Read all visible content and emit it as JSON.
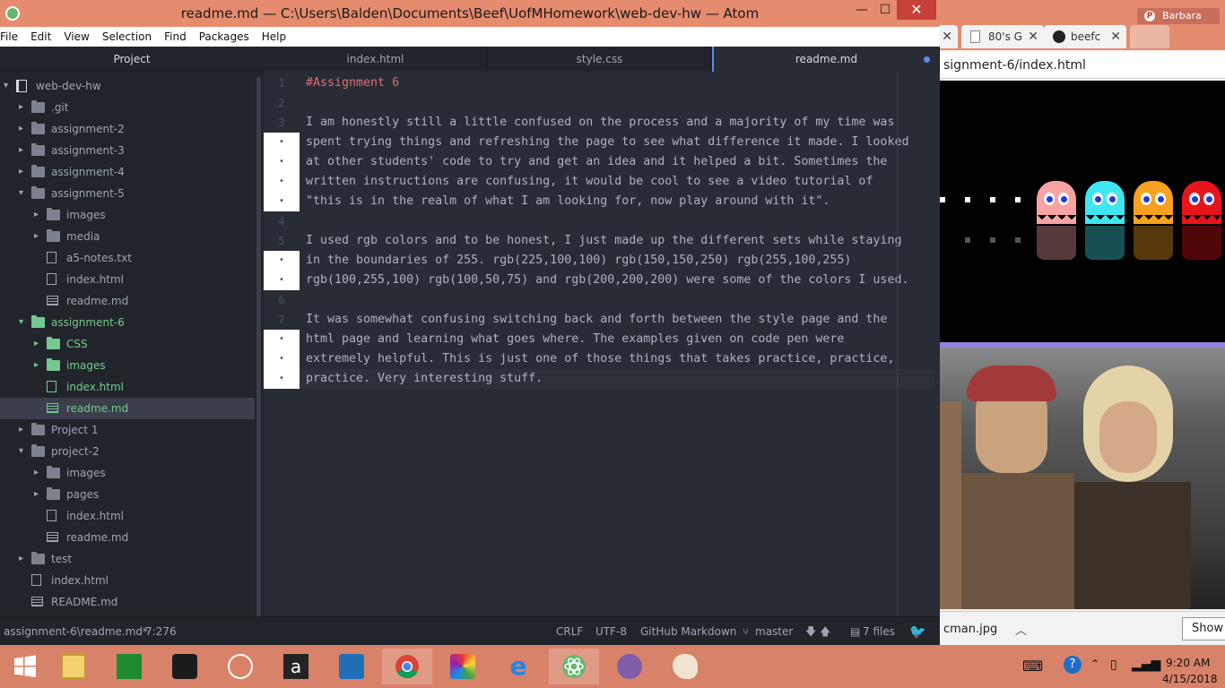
{
  "atom": {
    "title": "readme.md — C:\\Users\\Balden\\Documents\\Beef\\UofMHomework\\web-dev-hw — Atom",
    "window_buttons": {
      "minimize": "—",
      "maximize": "☐",
      "close": "✕"
    },
    "menu": [
      "File",
      "Edit",
      "View",
      "Selection",
      "Find",
      "Packages",
      "Help"
    ],
    "tree_view": {
      "header": "Project",
      "items": [
        {
          "label": "web-dev-hw",
          "type": "repo",
          "expanded": true
        },
        {
          "label": ".git",
          "type": "folder"
        },
        {
          "label": "assignment-2",
          "type": "folder"
        },
        {
          "label": "assignment-3",
          "type": "folder"
        },
        {
          "label": "assignment-4",
          "type": "folder"
        },
        {
          "label": "assignment-5",
          "type": "folder",
          "expanded": true
        },
        {
          "label": "images",
          "type": "folder"
        },
        {
          "label": "media",
          "type": "folder"
        },
        {
          "label": "a5-notes.txt",
          "type": "file"
        },
        {
          "label": "index.html",
          "type": "file"
        },
        {
          "label": "readme.md",
          "type": "md"
        },
        {
          "label": "assignment-6",
          "type": "folder",
          "expanded": true,
          "status": "modified"
        },
        {
          "label": "CSS",
          "type": "folder",
          "status": "modified"
        },
        {
          "label": "images",
          "type": "folder",
          "status": "modified"
        },
        {
          "label": "index.html",
          "type": "file",
          "status": "modified"
        },
        {
          "label": "readme.md",
          "type": "md",
          "status": "modified",
          "selected": true
        },
        {
          "label": "Project 1",
          "type": "folder"
        },
        {
          "label": "project-2",
          "type": "folder",
          "expanded": true
        },
        {
          "label": "images",
          "type": "folder"
        },
        {
          "label": "pages",
          "type": "folder"
        },
        {
          "label": "index.html",
          "type": "file"
        },
        {
          "label": "readme.md",
          "type": "md"
        },
        {
          "label": "test",
          "type": "folder"
        },
        {
          "label": "index.html",
          "type": "file"
        },
        {
          "label": "README.md",
          "type": "md"
        }
      ]
    },
    "tabs": [
      {
        "label": "index.html",
        "active": false
      },
      {
        "label": "style.css",
        "active": false
      },
      {
        "label": "readme.md",
        "active": true,
        "modified": true
      }
    ],
    "editor": {
      "gutter": [
        "1",
        "2",
        "3",
        "•",
        "•",
        "•",
        "•",
        "4",
        "5",
        "•",
        "•",
        "6",
        "7",
        "•",
        "•",
        "•"
      ],
      "lines": [
        "#Assignment 6",
        "",
        "I am honestly still a little confused on the process and a majority of my time was",
        "spent trying things and refreshing the page to see what difference it made. I looked",
        "at other students' code to try and get an idea and it helped a bit. Sometimes the",
        "written instructions are confusing, it would be cool to see a video tutorial of",
        "\"this is in the realm of what I am looking for, now play around with it\".",
        "",
        "I used rgb colors and to be honest, I just made up the different sets while staying",
        "in the boundaries of 255. rgb(225,100,100) rgb(150,150,250) rgb(255,100,255)",
        "rgb(100,255,100) rgb(100,50,75) and rgb(200,200,200) were some of the colors I used.",
        "",
        "It was somewhat confusing switching back and forth between the style page and the",
        "html page and learning what goes where. The examples given on code pen were",
        "extremely helpful. This is just one of those things that takes practice, practice,",
        "practice. Very interesting stuff."
      ]
    },
    "status_bar": {
      "file": "assignment-6\\readme.md*",
      "cursor": "7:276",
      "line_ending": "CRLF",
      "encoding": "UTF-8",
      "grammar": "GitHub Markdown",
      "branch": "master",
      "files": "7 files"
    }
  },
  "chrome": {
    "profile": "Barbara",
    "tabs": [
      {
        "label": "80's G"
      },
      {
        "label": "beefc"
      }
    ],
    "url": "signment-6/index.html",
    "download": {
      "file": "cman.jpg",
      "show_button": "Show"
    }
  },
  "taskbar": {
    "apps": [
      "start",
      "file-explorer",
      "store",
      "media-player",
      "hp",
      "amazon",
      "onedrive",
      "chrome",
      "puzzle",
      "internet-explorer",
      "atom",
      "github-desktop",
      "paint"
    ],
    "time": "9:20 AM",
    "date": "4/15/2018"
  },
  "colors": {
    "accent_orange": "#e58b6e",
    "atom_bg": "#282c34",
    "tree_bg": "#21252b",
    "git_modified_green": "#73c990",
    "tab_blue": "#568af2",
    "heading_red": "#e06c75"
  }
}
